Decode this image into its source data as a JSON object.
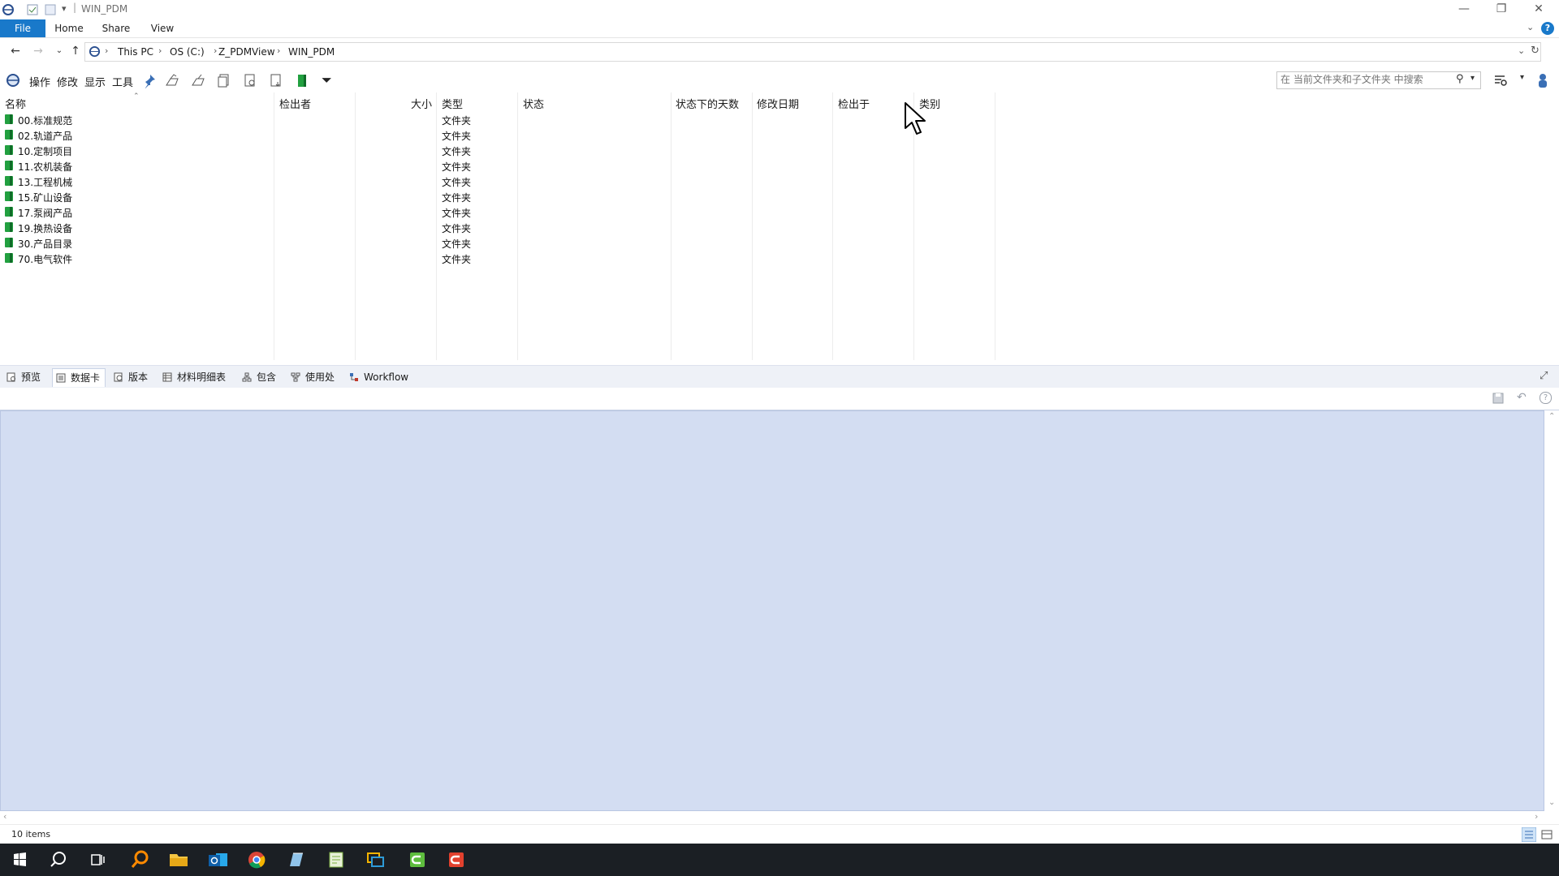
{
  "window": {
    "title": "WIN_PDM",
    "controls": {
      "minimize": "—",
      "restore": "❐",
      "close": "✕"
    }
  },
  "ribbon": {
    "tabs": [
      {
        "label": "File"
      },
      {
        "label": "Home"
      },
      {
        "label": "Share"
      },
      {
        "label": "View"
      }
    ]
  },
  "address": {
    "crumbs": [
      "This PC",
      "OS (C:)",
      "Z_PDMView",
      "WIN_PDM"
    ]
  },
  "pdm_toolbar": {
    "menus": [
      "操作",
      "修改",
      "显示",
      "工具"
    ],
    "search_placeholder": "在 当前文件夹和子文件夹 中搜索"
  },
  "file_list": {
    "columns": [
      "名称",
      "检出者",
      "大小",
      "类型",
      "状态",
      "状态下的天数",
      "修改日期",
      "检出于",
      "类别"
    ],
    "rows": [
      {
        "name": "00.标准规范",
        "type": "文件夹"
      },
      {
        "name": "02.轨道产品",
        "type": "文件夹"
      },
      {
        "name": "10.定制项目",
        "type": "文件夹"
      },
      {
        "name": "11.农机装备",
        "type": "文件夹"
      },
      {
        "name": "13.工程机械",
        "type": "文件夹"
      },
      {
        "name": "15.矿山设备",
        "type": "文件夹"
      },
      {
        "name": "17.泵阀产品",
        "type": "文件夹"
      },
      {
        "name": "19.换热设备",
        "type": "文件夹"
      },
      {
        "name": "30.产品目录",
        "type": "文件夹"
      },
      {
        "name": "70.电气软件",
        "type": "文件夹"
      }
    ]
  },
  "panel_tabs": [
    {
      "label": "预览",
      "active": false
    },
    {
      "label": "数据卡",
      "active": true
    },
    {
      "label": "版本",
      "active": false
    },
    {
      "label": "材料明细表",
      "active": false
    },
    {
      "label": "包含",
      "active": false
    },
    {
      "label": "使用处",
      "active": false
    },
    {
      "label": "Workflow",
      "active": false
    }
  ],
  "status": {
    "item_count": "10 items"
  },
  "colors": {
    "accent": "#1979ca",
    "datacard_bg": "#d3ddf2",
    "folder_green": "#22a040",
    "taskbar": "#1b1f24"
  },
  "taskbar_apps": [
    "windows-start-icon",
    "search-icon",
    "task-view-icon",
    "search-app-icon",
    "file-explorer-icon",
    "outlook-icon",
    "chrome-icon",
    "notepad-icon",
    "sheet-app-icon",
    "remote-desktop-icon",
    "green-c-app-icon",
    "red-c-app-icon"
  ]
}
